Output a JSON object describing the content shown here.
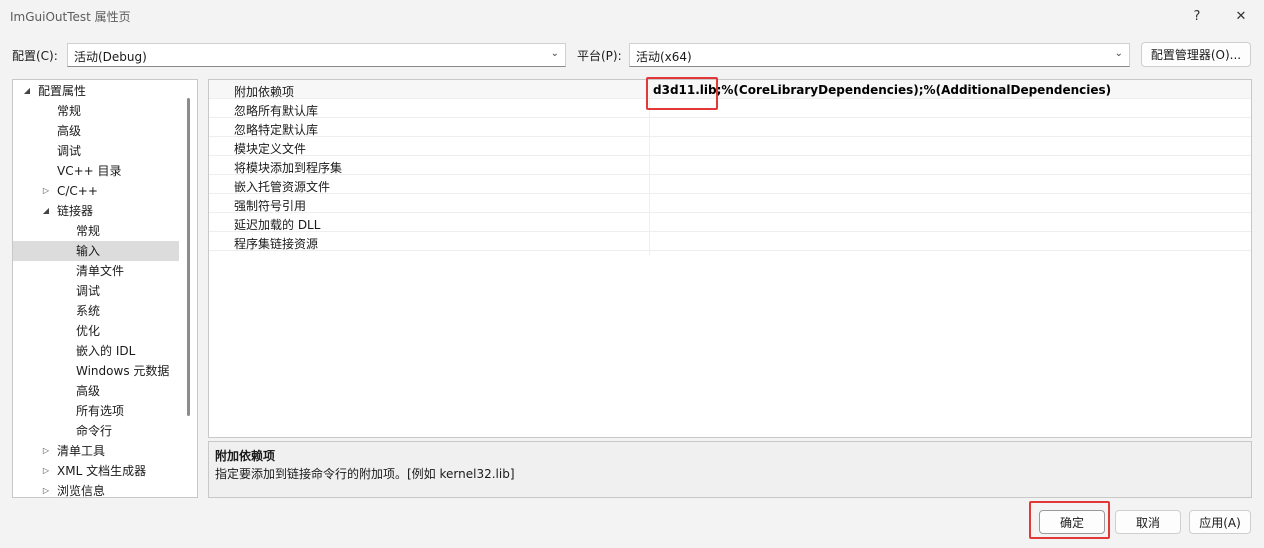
{
  "window": {
    "title": "ImGuiOutTest 属性页",
    "help_label": "?",
    "close_label": "✕"
  },
  "config": {
    "config_label": "配置(C):",
    "config_value": "活动(Debug)",
    "platform_label": "平台(P):",
    "platform_value": "活动(x64)",
    "manager_button": "配置管理器(O)..."
  },
  "tree": {
    "items": [
      {
        "label": "配置属性"
      },
      {
        "label": "常规"
      },
      {
        "label": "高级"
      },
      {
        "label": "调试"
      },
      {
        "label": "VC++ 目录"
      },
      {
        "label": "C/C++"
      },
      {
        "label": "链接器"
      },
      {
        "label": "常规"
      },
      {
        "label": "输入"
      },
      {
        "label": "清单文件"
      },
      {
        "label": "调试"
      },
      {
        "label": "系统"
      },
      {
        "label": "优化"
      },
      {
        "label": "嵌入的 IDL"
      },
      {
        "label": "Windows 元数据"
      },
      {
        "label": "高级"
      },
      {
        "label": "所有选项"
      },
      {
        "label": "命令行"
      },
      {
        "label": "清单工具"
      },
      {
        "label": "XML 文档生成器"
      },
      {
        "label": "浏览信息"
      }
    ]
  },
  "grid": {
    "rows": [
      {
        "name": "附加依赖项",
        "value": "d3d11.lib;%(CoreLibraryDependencies);%(AdditionalDependencies)"
      },
      {
        "name": "忽略所有默认库",
        "value": ""
      },
      {
        "name": "忽略特定默认库",
        "value": ""
      },
      {
        "name": "模块定义文件",
        "value": ""
      },
      {
        "name": "将模块添加到程序集",
        "value": ""
      },
      {
        "name": "嵌入托管资源文件",
        "value": ""
      },
      {
        "name": "强制符号引用",
        "value": ""
      },
      {
        "name": "延迟加载的 DLL",
        "value": ""
      },
      {
        "name": "程序集链接资源",
        "value": ""
      }
    ]
  },
  "description": {
    "title": "附加依赖项",
    "text": "指定要添加到链接命令行的附加项。[例如 kernel32.lib]"
  },
  "footer": {
    "ok_label": "确定",
    "cancel_label": "取消",
    "apply_label": "应用(A)"
  },
  "colors": {
    "highlight": "#e23838",
    "selection": "#dcdcdc"
  }
}
